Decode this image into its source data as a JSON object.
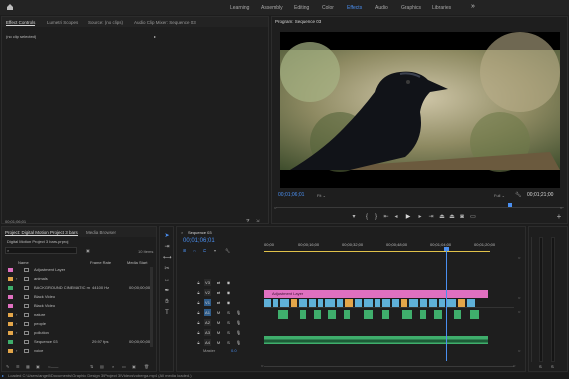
{
  "top_nav": {
    "home_icon": "home-icon",
    "workspaces": [
      "Learning",
      "Assembly",
      "Editing",
      "Color",
      "Effects",
      "Audio",
      "Graphics",
      "Libraries"
    ],
    "active": "Effects",
    "more": "»"
  },
  "source_panel": {
    "tabs": [
      "Effect Controls",
      "Lumetri Scopes",
      "Source: (no clips)",
      "Audio Clip Mixer: Sequence 03"
    ],
    "active_tab": "Effect Controls",
    "status": "(no clip selected)",
    "timecode": "00;01;06;01"
  },
  "program_monitor": {
    "title": "Program: Sequence 03",
    "timecode": "00;01;06;01",
    "fit": "Fit",
    "quality": "Full",
    "duration": "00;01;21;00"
  },
  "project_panel": {
    "tabs": [
      "Project: Digital Motion Project 3 bars",
      "Media Browser"
    ],
    "project_file": "Digital Motion Project 3 bars.prproj",
    "item_count": "10 Items",
    "columns": [
      "Name",
      "Frame Rate",
      "Media Start"
    ],
    "rows": [
      {
        "name": "Adjustment Layer",
        "frame_rate": "",
        "media_start": "",
        "color": "#e070c0",
        "expander": ""
      },
      {
        "name": "animals",
        "frame_rate": "",
        "media_start": "",
        "color": "#e3a64a",
        "expander": "›"
      },
      {
        "name": "BACKGROUND CINEMATIC m",
        "frame_rate": "44100 Hz",
        "media_start": "00;00;00;00",
        "color": "#3fae6c",
        "expander": ""
      },
      {
        "name": "Black Video",
        "frame_rate": "",
        "media_start": "",
        "color": "#e070c0",
        "expander": ""
      },
      {
        "name": "Black Video",
        "frame_rate": "",
        "media_start": "",
        "color": "#e070c0",
        "expander": ""
      },
      {
        "name": "nature",
        "frame_rate": "",
        "media_start": "",
        "color": "#e3a64a",
        "expander": "›"
      },
      {
        "name": "people",
        "frame_rate": "",
        "media_start": "",
        "color": "#e3a64a",
        "expander": "›"
      },
      {
        "name": "pollution",
        "frame_rate": "",
        "media_start": "",
        "color": "#e3a64a",
        "expander": "›"
      },
      {
        "name": "Sequence 03",
        "frame_rate": "29.97 fps",
        "media_start": "00;00;00;00",
        "color": "#3fae6c",
        "expander": ""
      },
      {
        "name": "voice",
        "frame_rate": "",
        "media_start": "",
        "color": "#e3a64a",
        "expander": "›"
      }
    ]
  },
  "timeline": {
    "tab": "Sequence 03",
    "timecode": "00;01;06;01",
    "ruler_labels": [
      "00;00",
      "00;00;16;00",
      "00;00;32;00",
      "00;00;48;00",
      "00;01;04;00",
      "00;01;20;00"
    ],
    "tracks": [
      {
        "id": "V3",
        "kind": "video"
      },
      {
        "id": "V2",
        "kind": "video"
      },
      {
        "id": "V1",
        "kind": "video"
      },
      {
        "id": "A1",
        "kind": "audio"
      },
      {
        "id": "A2",
        "kind": "audio"
      },
      {
        "id": "A3",
        "kind": "audio"
      },
      {
        "id": "A4",
        "kind": "audio"
      }
    ],
    "adjustment_clip": "Adjustment Layer",
    "master_label": "Master",
    "master_value": "0.0"
  },
  "meter": {
    "labels": [
      "S",
      "S"
    ]
  },
  "status_bar": {
    "text": "Loaded C:\\Users\\angeli\\Documents\\Graphic Design 3\\Project 3\\Videos\\roberga.mp4 (All media loaded.)"
  },
  "colors": {
    "accent": "#4a8ff0",
    "adjustment": "#e070c0",
    "video": "#5fb0d8",
    "audio": "#3fae6c",
    "folder": "#e3a64a"
  }
}
